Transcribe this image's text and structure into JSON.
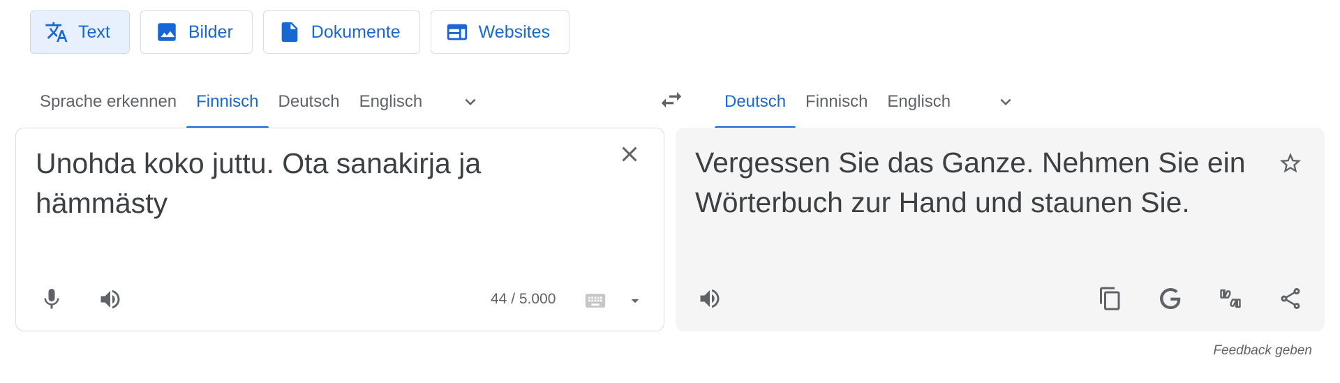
{
  "mode_tabs": [
    {
      "label": "Text",
      "icon": "translate-icon",
      "active": true
    },
    {
      "label": "Bilder",
      "icon": "image-icon",
      "active": false
    },
    {
      "label": "Dokumente",
      "icon": "document-icon",
      "active": false
    },
    {
      "label": "Websites",
      "icon": "website-icon",
      "active": false
    }
  ],
  "source_langs": [
    "Sprache erkennen",
    "Finnisch",
    "Deutsch",
    "Englisch"
  ],
  "source_active": "Finnisch",
  "target_langs": [
    "Deutsch",
    "Finnisch",
    "Englisch"
  ],
  "target_active": "Deutsch",
  "source": {
    "text": "Unohda koko juttu. Ota sanakirja ja\nhämmästy",
    "char_count": "44 / 5.000"
  },
  "target": {
    "text": "Vergessen Sie das Ganze. Nehmen Sie ein\nWörterbuch zur Hand und staunen Sie."
  },
  "feedback_label": "Feedback geben",
  "colors": {
    "accent": "#1967d2",
    "active_bg": "#e8f0fe",
    "panel_bg": "#f5f5f5",
    "icon": "#5f6368"
  }
}
